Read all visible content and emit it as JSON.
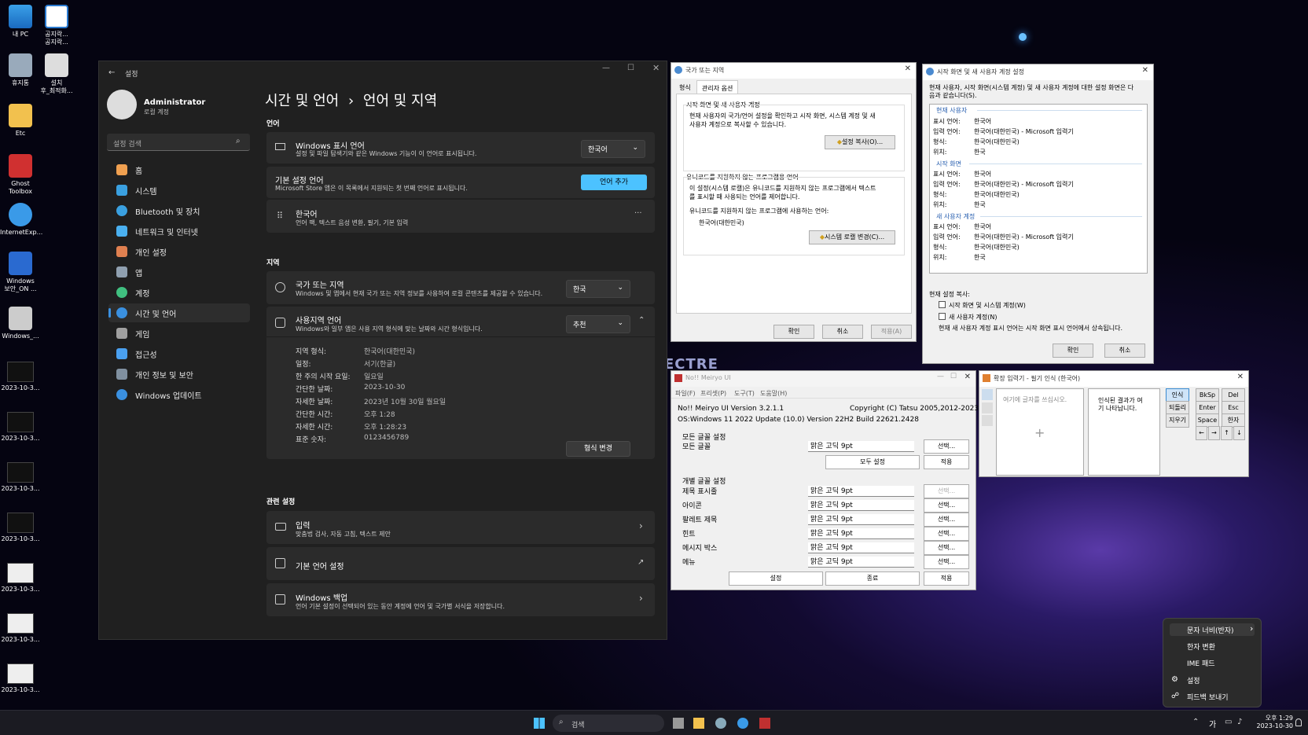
{
  "desktop": {
    "icons": [
      "내 PC",
      "공지락...\n공지락...",
      "휴지통",
      "설치\n후_최적화...",
      "Etc",
      "Ghost\nToolbox",
      "InternetExp...",
      "Windows\n보안_ON ...",
      "Windows_...",
      "2023-10-3...",
      "2023-10-3...",
      "2023-10-3...",
      "2023-10-3...",
      "2023-10-3...",
      "2023-10-3...",
      "2023-10-3..."
    ],
    "wallpaper_text": "ECTRE"
  },
  "settings": {
    "title": "설정",
    "user": "Administrator",
    "account": "로컬 계정",
    "search_placeholder": "설정 검색",
    "nav": [
      {
        "label": "홈",
        "color": "#f0a050"
      },
      {
        "label": "시스템",
        "color": "#3aa0e0"
      },
      {
        "label": "Bluetooth 및 장치",
        "color": "#3aa0e0"
      },
      {
        "label": "네트워크 및 인터넷",
        "color": "#4ab0f0"
      },
      {
        "label": "개인 설정",
        "color": "#e08050"
      },
      {
        "label": "앱",
        "color": "#90a0b0"
      },
      {
        "label": "계정",
        "color": "#40c080"
      },
      {
        "label": "시간 및 언어",
        "color": "#3a90e0"
      },
      {
        "label": "게임",
        "color": "#a0a0a0"
      },
      {
        "label": "접근성",
        "color": "#4aa0f0"
      },
      {
        "label": "개인 정보 및 보안",
        "color": "#8090a0"
      },
      {
        "label": "Windows 업데이트",
        "color": "#3a90e0"
      }
    ],
    "breadcrumb_parent": "시간 및 언어",
    "breadcrumb_sep": "›",
    "breadcrumb_current": "언어 및 지역",
    "section_language": "언어",
    "display_lang_title": "Windows 표시 언어",
    "display_lang_desc": "설정 및 파일 탐색기와 같은 Windows 기능이 이 언어로 표시됩니다.",
    "display_lang_value": "한국어",
    "pref_lang_title": "기본 설정 언어",
    "pref_lang_desc": "Microsoft Store 앱은 이 목록에서 지원되는 첫 번째 언어로 표시됩니다.",
    "add_lang": "언어 추가",
    "korean_title": "한국어",
    "korean_desc": "언어 팩, 텍스트 음성 변환, 필기, 기본 입력",
    "more": "···",
    "section_region": "지역",
    "country_title": "국가 또는 지역",
    "country_desc": "Windows 및 앱에서 현재 국가 또는 지역 정보를 사용하여 로컬 콘텐츠를 제공할 수 있습니다.",
    "country_value": "한국",
    "regional_title": "사용지역 언어",
    "regional_desc": "Windows와 일부 앱은 사용 지역 형식에 맞는 날짜와 시간 형식입니다.",
    "regional_value": "추천",
    "formats": [
      {
        "k": "지역 형식:",
        "v": "한국어(대한민국)"
      },
      {
        "k": "일정:",
        "v": "서기(한글)"
      },
      {
        "k": "한 주의 시작 요일:",
        "v": "일요일"
      },
      {
        "k": "간단한 날짜:",
        "v": "2023-10-30"
      },
      {
        "k": "자세한 날짜:",
        "v": "2023년 10월 30일 월요일"
      },
      {
        "k": "간단한 시간:",
        "v": "오후 1:28"
      },
      {
        "k": "자세한 시간:",
        "v": "오후 1:28:23"
      },
      {
        "k": "표준 숫자:",
        "v": "0123456789"
      }
    ],
    "change_format": "형식 변경",
    "section_related": "관련 설정",
    "typing_title": "입력",
    "typing_desc": "맞춤법 검사, 자동 고침, 텍스트 제안",
    "admin_lang_title": "기본 언어 설정",
    "backup_title": "Windows 백업",
    "backup_desc": "언어 기본 설정이 선택되어 있는 동안 계정에 언어 및 국가별 서식을 저장합니다."
  },
  "region_dialog": {
    "title": "국가 또는 지역",
    "tab1": "형식",
    "tab2": "관리자 옵션",
    "g1_title": "시작 화면 및 새 사용자 계정",
    "g1_text": "현재 사용자의 국가/언어 설정을 확인하고 시작 화면, 시스템 계정 및 새\n사용자 계정으로 복사할 수 있습니다.",
    "copy_btn": "설정 복사(O)...",
    "g2_title": "유니코드를 지원하지 않는 프로그램용 언어",
    "g2_text": "이 설정(시스템 로캘)은 유니코드를 지원하지 않는 프로그램에서 텍스트\n를 표시할 때 사용되는 언어를 제어합니다.",
    "g2_label": "유니코드를 지원하지 않는 프로그램에 사용하는 언어:",
    "g2_value": "한국어(대한민국)",
    "locale_btn": "시스템 로캘 변경(C)...",
    "ok": "확인",
    "cancel": "취소",
    "apply": "적용(A)"
  },
  "welcome_dialog": {
    "title": "시작 화면 및 새 사용자 계정 설정",
    "intro": "현재 사용자, 시작 화면(시스템 계정) 및 새 사용자 계정에 대한 설정 화면은 다\n음과 같습니다(S).",
    "groups": [
      {
        "name": "현재 사용자",
        "rows": [
          [
            "표시 언어:",
            "한국어"
          ],
          [
            "입력 언어:",
            "한국어(대한민국) - Microsoft 입력기"
          ],
          [
            "형식:",
            "한국어(대한민국)"
          ],
          [
            "위치:",
            "한국"
          ]
        ]
      },
      {
        "name": "시작 화면",
        "rows": [
          [
            "표시 언어:",
            "한국어"
          ],
          [
            "입력 언어:",
            "한국어(대한민국) - Microsoft 입력기"
          ],
          [
            "형식:",
            "한국어(대한민국)"
          ],
          [
            "위치:",
            "한국"
          ]
        ]
      },
      {
        "name": "새 사용자 계정",
        "rows": [
          [
            "표시 언어:",
            "한국어"
          ],
          [
            "입력 언어:",
            "한국어(대한민국) - Microsoft 입력기"
          ],
          [
            "형식:",
            "한국어(대한민국)"
          ],
          [
            "위치:",
            "한국"
          ]
        ]
      }
    ],
    "copy_label": "현재 설정 복사:",
    "chk1": "시작 화면 및 시스템 계정(W)",
    "chk2": "새 사용자 계정(N)",
    "note": "현재 새 사용자 계정 표시 언어는 시작 화면 표시 언어에서 상속됩니다.",
    "ok": "확인",
    "cancel": "취소"
  },
  "meiryo": {
    "title": "No!! Meiryo UI",
    "menus": [
      "파일(F)",
      "프리셋(P)",
      "도구(T)",
      "도움말(H)"
    ],
    "version": "No!! Meiryo UI Version 3.2.1.1",
    "copyright": "Copyright (C) Tatsu 2005,2012-2023",
    "os": "OS:Windows 11 2022 Update (10.0) Version 22H2 Build 22621.2428",
    "all_head": "모든 글꼴 설정",
    "all_label": "모든 글꼴",
    "font_value": "맑은 고딕  9pt",
    "select": "선택...",
    "all_set": "모두 설정",
    "apply": "적용",
    "indiv_head": "개별 글꼴 설정",
    "items": [
      "제목 표시줄",
      "아이콘",
      "팔레트 제목",
      "힌트",
      "메시지 박스",
      "메뉴"
    ],
    "set": "설정",
    "close": "종료"
  },
  "ime_pad": {
    "title": "확장 입력기 - 필기 인식 (한국어)",
    "placeholder": "여기에 글자를 쓰십시오.",
    "result": "인식된 결과가 여\n기 나타납니다.",
    "btns": [
      "인식",
      "되돌리기",
      "지우기"
    ],
    "keys": [
      "BkSp",
      "Del",
      "Enter",
      "Esc",
      "Space",
      "한자"
    ],
    "arrows": [
      "←",
      "→",
      "↑",
      "↓"
    ]
  },
  "context_menu": {
    "items": [
      "문자 너비(반자)",
      "한자 변환",
      "IME 패드",
      "설정",
      "피드백 보내기"
    ],
    "chevron": "›"
  },
  "taskbar": {
    "search": "검색",
    "ime": "가",
    "time": "오후 1:29",
    "date": "2023-10-30"
  }
}
